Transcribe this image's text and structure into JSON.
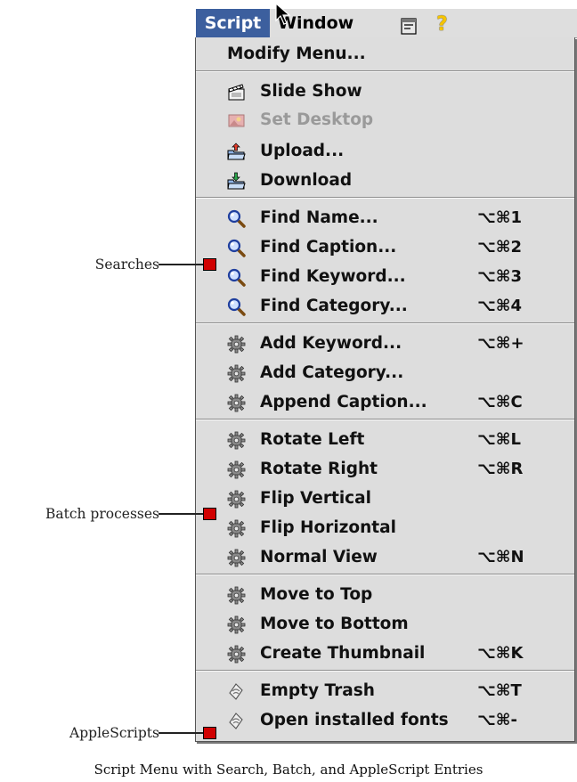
{
  "menubar": {
    "script_label": "Script",
    "window_label": "Window",
    "apps_icon": "application-menu-icon",
    "help_glyph": "?"
  },
  "menu": {
    "items": [
      {
        "label": "Modify Menu...",
        "shortcut": "",
        "icon": "none",
        "enabled": true
      },
      {
        "label": "Slide Show",
        "shortcut": "",
        "icon": "clapper-icon",
        "enabled": true
      },
      {
        "label": "Set Desktop",
        "shortcut": "",
        "icon": "picture-icon",
        "enabled": false
      },
      {
        "label": "Upload...",
        "shortcut": "",
        "icon": "folder-upload-icon",
        "enabled": true
      },
      {
        "label": "Download",
        "shortcut": "",
        "icon": "folder-download-icon",
        "enabled": true
      },
      {
        "label": "Find Name...",
        "shortcut": "⌥⌘1",
        "icon": "magnifier-icon",
        "enabled": true
      },
      {
        "label": "Find Caption...",
        "shortcut": "⌥⌘2",
        "icon": "magnifier-icon",
        "enabled": true
      },
      {
        "label": "Find Keyword...",
        "shortcut": "⌥⌘3",
        "icon": "magnifier-icon",
        "enabled": true
      },
      {
        "label": "Find Category...",
        "shortcut": "⌥⌘4",
        "icon": "magnifier-icon",
        "enabled": true
      },
      {
        "label": "Add Keyword...",
        "shortcut": "⌥⌘+",
        "icon": "gear-icon",
        "enabled": true
      },
      {
        "label": "Add Category...",
        "shortcut": "",
        "icon": "gear-icon",
        "enabled": true
      },
      {
        "label": "Append Caption...",
        "shortcut": "⌥⌘C",
        "icon": "gear-icon",
        "enabled": true
      },
      {
        "label": "Rotate Left",
        "shortcut": "⌥⌘L",
        "icon": "gear-icon",
        "enabled": true
      },
      {
        "label": "Rotate Right",
        "shortcut": "⌥⌘R",
        "icon": "gear-icon",
        "enabled": true
      },
      {
        "label": "Flip Vertical",
        "shortcut": "",
        "icon": "gear-icon",
        "enabled": true
      },
      {
        "label": "Flip Horizontal",
        "shortcut": "",
        "icon": "gear-icon",
        "enabled": true
      },
      {
        "label": "Normal View",
        "shortcut": "⌥⌘N",
        "icon": "gear-icon",
        "enabled": true
      },
      {
        "label": "Move to Top",
        "shortcut": "",
        "icon": "gear-icon",
        "enabled": true
      },
      {
        "label": "Move to Bottom",
        "shortcut": "",
        "icon": "gear-icon",
        "enabled": true
      },
      {
        "label": "Create Thumbnail",
        "shortcut": "⌥⌘K",
        "icon": "gear-icon",
        "enabled": true
      },
      {
        "label": "Empty Trash",
        "shortcut": "⌥⌘T",
        "icon": "applescript-icon",
        "enabled": true
      },
      {
        "label": "Open installed fonts",
        "shortcut": "⌥⌘-",
        "icon": "applescript-icon",
        "enabled": true
      }
    ]
  },
  "callouts": {
    "searches": "Searches",
    "batch": "Batch processes",
    "applescripts": "AppleScripts"
  },
  "caption": "Script Menu with Search, Batch, and AppleScript Entries",
  "colors": {
    "menubar_highlight": "#3c5f9e",
    "menu_background": "#dddddd",
    "marker": "#d00000",
    "disabled_text": "#9a9a9a"
  }
}
